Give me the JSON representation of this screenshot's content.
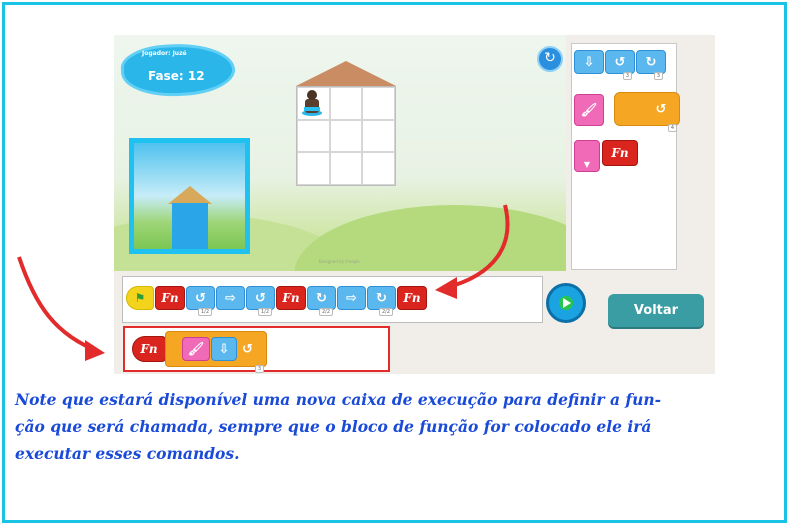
{
  "game": {
    "player_label": "Jogador: Juzé",
    "phase_label": "Fase: 12",
    "reset_icon": "reset-icon",
    "credit": "Designed by Freepik"
  },
  "palette": {
    "blocks": [
      {
        "kind": "move-down",
        "color": "#5bb8ef"
      },
      {
        "kind": "turn-left",
        "color": "#5bb8ef",
        "count": "3"
      },
      {
        "kind": "turn-right",
        "color": "#5bb8ef",
        "count": "3"
      },
      {
        "kind": "paint",
        "color": "#f06ab8"
      },
      {
        "kind": "repeat",
        "color": "#f5a623",
        "count": "4"
      },
      {
        "kind": "function-define",
        "color": "#f06ab8"
      },
      {
        "kind": "function",
        "label": "Fn",
        "color": "#d9251d"
      }
    ]
  },
  "main_program": {
    "blocks": [
      {
        "kind": "start-flag"
      },
      {
        "kind": "function",
        "label": "Fn"
      },
      {
        "kind": "turn-left",
        "count": "1/2"
      },
      {
        "kind": "forward"
      },
      {
        "kind": "turn-left",
        "count": "1/2"
      },
      {
        "kind": "function",
        "label": "Fn"
      },
      {
        "kind": "turn-right",
        "count": "2/2"
      },
      {
        "kind": "forward"
      },
      {
        "kind": "turn-right",
        "count": "2/2"
      },
      {
        "kind": "function",
        "label": "Fn"
      }
    ]
  },
  "function_program": {
    "blocks": [
      {
        "kind": "function-header",
        "label": "Fn"
      },
      {
        "kind": "paint"
      },
      {
        "kind": "move-down"
      },
      {
        "kind": "repeat",
        "count": "3"
      }
    ]
  },
  "controls": {
    "play_icon": "play-icon",
    "back_label": "Voltar"
  },
  "caption": "Note que estará disponível uma nova caixa de execução para definir a fun-ção que será chamada, sempre que o bloco de função for colocado ele irá executar esses comandos.",
  "caption_lines": [
    "Note que estará disponível uma nova caixa de execução para definir a fun-",
    "ção que será chamada, sempre que o bloco de função for colocado ele irá",
    "executar esses comandos."
  ],
  "colors": {
    "frame_border": "#19c3e6",
    "caption": "#1a4ad8",
    "highlight": "#e22b2b",
    "back_button": "#3a9da3"
  }
}
